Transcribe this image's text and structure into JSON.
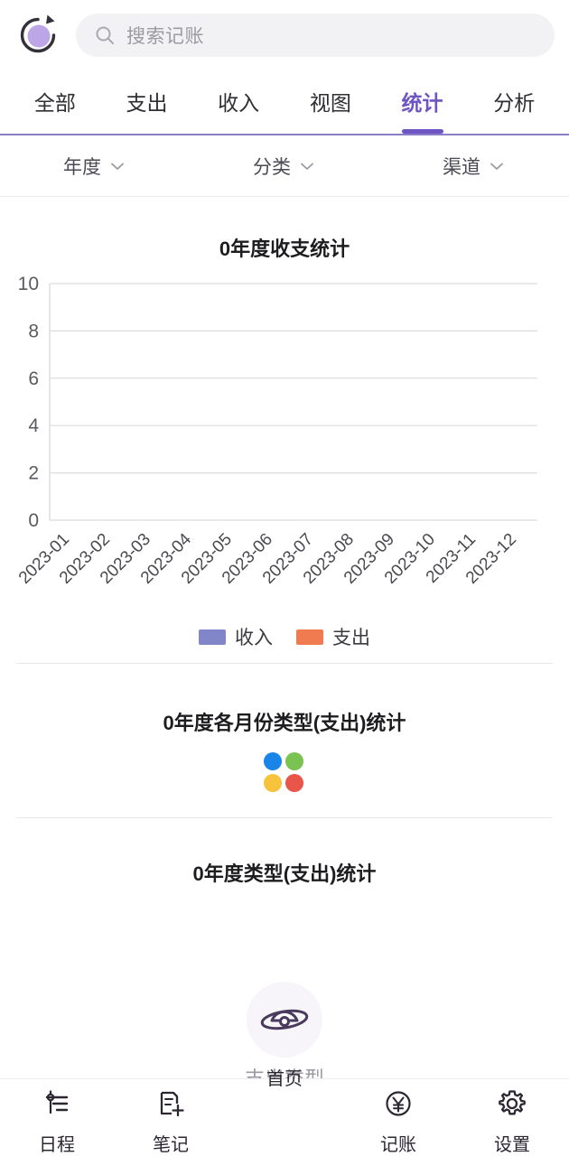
{
  "theme": {
    "accent": "#6f55c4",
    "income_color": "#8186c9",
    "expense_color": "#f07b50",
    "muted_text": "#9b9ba1",
    "text": "#2e2e33",
    "bg": "#ffffff",
    "search_bg": "#f2f2f4",
    "divider": "#e8e8ea"
  },
  "header": {
    "logo_icon": "refresh-circle-icon",
    "search": {
      "icon": "search-icon",
      "placeholder": "搜索记账",
      "value": ""
    }
  },
  "tabs": [
    {
      "label": "全部",
      "active": false
    },
    {
      "label": "支出",
      "active": false
    },
    {
      "label": "收入",
      "active": false
    },
    {
      "label": "视图",
      "active": false
    },
    {
      "label": "统计",
      "active": true
    },
    {
      "label": "分析",
      "active": false
    }
  ],
  "filters": [
    {
      "label": "年度",
      "icon": "chevron-down-icon"
    },
    {
      "label": "分类",
      "icon": "chevron-down-icon"
    },
    {
      "label": "渠道",
      "icon": "chevron-down-icon"
    }
  ],
  "sections": [
    {
      "title": "0年度收支统计"
    },
    {
      "title": "0年度各月份类型(支出)统计"
    },
    {
      "title": "0年度类型(支出)统计"
    }
  ],
  "loader": {
    "name": "loading-dots",
    "colors": [
      "#1a85e8",
      "#7ac252",
      "#f7c33c",
      "#e8564a"
    ]
  },
  "pie_placeholder_label": "支出类型",
  "bottom_nav": [
    {
      "label": "日程",
      "icon": "sliders-icon",
      "active": false
    },
    {
      "label": "笔记",
      "icon": "note-add-icon",
      "active": false
    },
    {
      "label": "首页",
      "icon": "planet-icon",
      "active": true
    },
    {
      "label": "记账",
      "icon": "yen-circle-icon",
      "active": false
    },
    {
      "label": "设置",
      "icon": "gear-icon",
      "active": false
    }
  ],
  "chart_data": {
    "type": "bar",
    "title": "0年度收支统计",
    "categories": [
      "2023-01",
      "2023-02",
      "2023-03",
      "2023-04",
      "2023-05",
      "2023-06",
      "2023-07",
      "2023-08",
      "2023-09",
      "2023-10",
      "2023-11",
      "2023-12"
    ],
    "series": [
      {
        "name": "收入",
        "color": "#8186c9",
        "values": [
          0,
          0,
          0,
          0,
          0,
          0,
          0,
          0,
          0,
          0,
          0,
          0
        ]
      },
      {
        "name": "支出",
        "color": "#f07b50",
        "values": [
          0,
          0,
          0,
          0,
          0,
          0,
          0,
          0,
          0,
          0,
          0,
          0
        ]
      }
    ],
    "xlabel": "",
    "ylabel": "",
    "ylim": [
      0,
      10
    ],
    "yticks": [
      0,
      2,
      4,
      6,
      8,
      10
    ],
    "grid": true,
    "legend_position": "bottom",
    "xtick_rotation": -45,
    "empty": true
  }
}
